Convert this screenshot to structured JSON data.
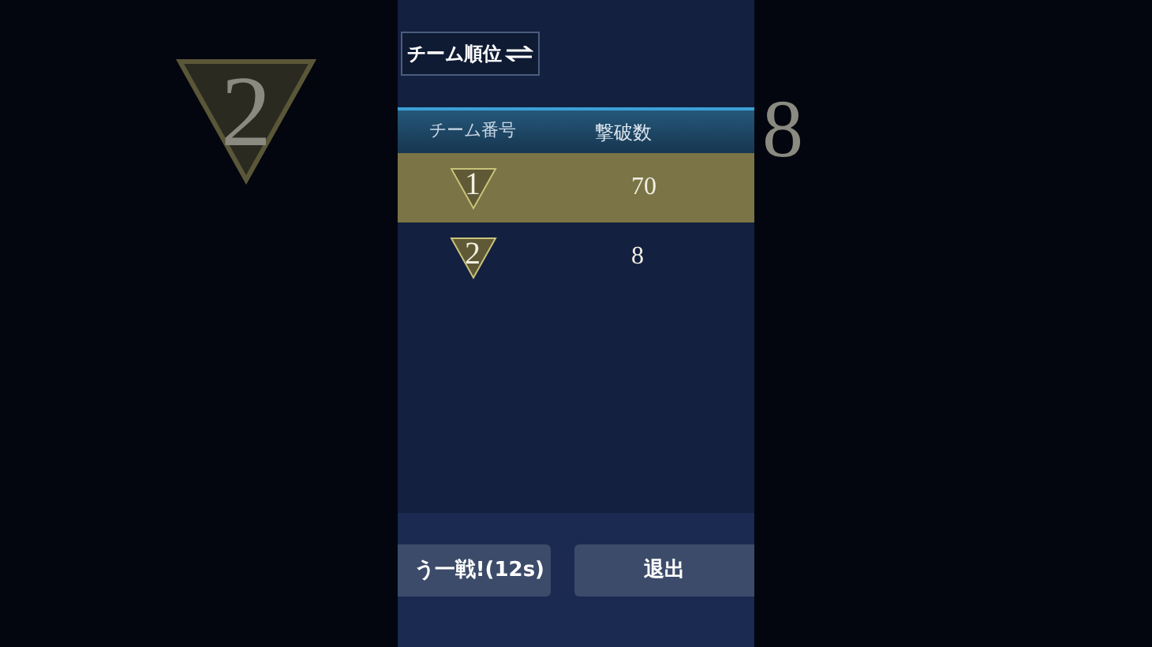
{
  "backdrop": {
    "left_rank": "2",
    "right_kills": "8"
  },
  "title_button": "チーム順位",
  "table": {
    "columns": [
      "チーム番号",
      "撃破数"
    ],
    "rows": [
      {
        "team": "1",
        "kills": "70",
        "selected": true
      },
      {
        "team": "2",
        "kills": "8",
        "selected": false
      }
    ]
  },
  "buttons": [
    {
      "label": "う一戦!(12s)"
    },
    {
      "label": "退出"
    }
  ]
}
